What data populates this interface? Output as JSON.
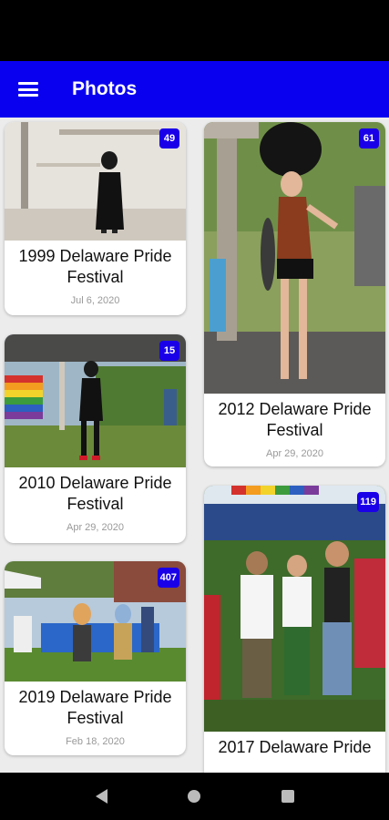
{
  "app_bar": {
    "title": "Photos",
    "menu_icon": "hamburger-menu-icon"
  },
  "albums": [
    {
      "title": "1999 Delaware Pride Festival",
      "date": "Jul 6, 2020",
      "count": "49"
    },
    {
      "title": "2012 Delaware Pride Festival",
      "date": "Apr 29, 2020",
      "count": "61"
    },
    {
      "title": "2010 Delaware Pride Festival",
      "date": "Apr 29, 2020",
      "count": "15"
    },
    {
      "title": "2019 Delaware Pride Festival",
      "date": "Feb 18, 2020",
      "count": "407"
    },
    {
      "title": "2017 Delaware Pride",
      "date": "",
      "count": "119"
    }
  ],
  "nav": {
    "back_icon": "back-icon",
    "home_icon": "home-icon",
    "recent_icon": "recent-apps-icon"
  },
  "colors": {
    "accent": "#0a00f0",
    "badge": "#1a00e8"
  }
}
